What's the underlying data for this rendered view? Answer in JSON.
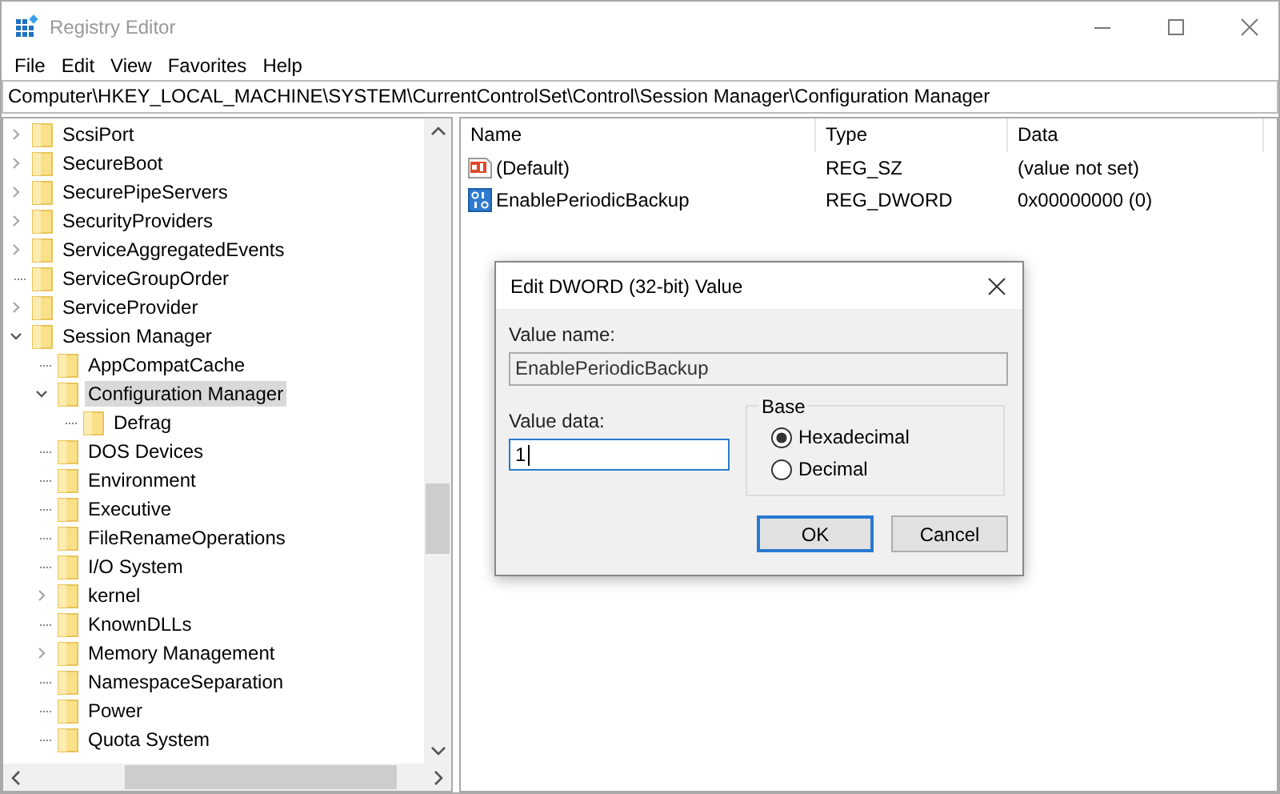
{
  "window": {
    "title": "Registry Editor"
  },
  "menu": [
    "File",
    "Edit",
    "View",
    "Favorites",
    "Help"
  ],
  "address": "Computer\\HKEY_LOCAL_MACHINE\\SYSTEM\\CurrentControlSet\\Control\\Session Manager\\Configuration Manager",
  "tree": [
    {
      "label": "ScsiPort",
      "expandable": true,
      "expanded": false,
      "selected": false
    },
    {
      "label": "SecureBoot",
      "expandable": true,
      "expanded": false,
      "selected": false
    },
    {
      "label": "SecurePipeServers",
      "expandable": true,
      "expanded": false,
      "selected": false
    },
    {
      "label": "SecurityProviders",
      "expandable": true,
      "expanded": false,
      "selected": false
    },
    {
      "label": "ServiceAggregatedEvents",
      "expandable": true,
      "expanded": false,
      "selected": false
    },
    {
      "label": "ServiceGroupOrder",
      "expandable": false,
      "selected": false
    },
    {
      "label": "ServiceProvider",
      "expandable": true,
      "expanded": false,
      "selected": false
    },
    {
      "label": "Session Manager",
      "expandable": true,
      "expanded": true,
      "selected": false,
      "children": [
        {
          "label": "AppCompatCache",
          "expandable": false,
          "selected": false
        },
        {
          "label": "Configuration Manager",
          "expandable": true,
          "expanded": true,
          "selected": true,
          "children": [
            {
              "label": "Defrag",
              "expandable": false,
              "selected": false
            }
          ]
        },
        {
          "label": "DOS Devices",
          "expandable": false,
          "selected": false
        },
        {
          "label": "Environment",
          "expandable": false,
          "selected": false
        },
        {
          "label": "Executive",
          "expandable": false,
          "selected": false
        },
        {
          "label": "FileRenameOperations",
          "expandable": false,
          "selected": false
        },
        {
          "label": "I/O System",
          "expandable": false,
          "selected": false
        },
        {
          "label": "kernel",
          "expandable": true,
          "expanded": false,
          "selected": false
        },
        {
          "label": "KnownDLLs",
          "expandable": false,
          "selected": false
        },
        {
          "label": "Memory Management",
          "expandable": true,
          "expanded": false,
          "selected": false
        },
        {
          "label": "NamespaceSeparation",
          "expandable": false,
          "selected": false
        },
        {
          "label": "Power",
          "expandable": false,
          "selected": false
        },
        {
          "label": "Quota System",
          "expandable": false,
          "selected": false
        }
      ]
    }
  ],
  "values": {
    "columns": [
      "Name",
      "Type",
      "Data"
    ],
    "rows": [
      {
        "kind": "string",
        "name": "(Default)",
        "type": "REG_SZ",
        "data": "(value not set)"
      },
      {
        "kind": "dword",
        "name": "EnablePeriodicBackup",
        "type": "REG_DWORD",
        "data": "0x00000000 (0)"
      }
    ]
  },
  "dialog": {
    "title": "Edit DWORD (32-bit) Value",
    "value_name_label": "Value name:",
    "value_name": "EnablePeriodicBackup",
    "value_data_label": "Value data:",
    "value_data": "1",
    "base_label": "Base",
    "bases": [
      {
        "label": "Hexadecimal",
        "selected": true
      },
      {
        "label": "Decimal",
        "selected": false
      }
    ],
    "buttons": [
      {
        "label": "OK",
        "default": true
      },
      {
        "label": "Cancel",
        "default": false
      }
    ]
  }
}
